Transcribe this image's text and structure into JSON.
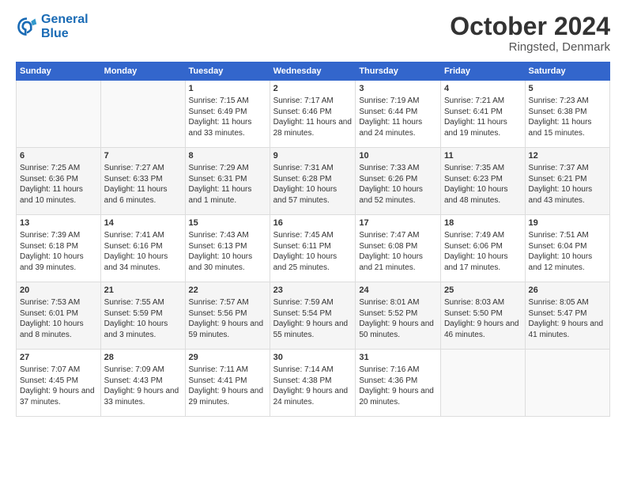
{
  "header": {
    "logo_line1": "General",
    "logo_line2": "Blue",
    "month": "October 2024",
    "location": "Ringsted, Denmark"
  },
  "days_of_week": [
    "Sunday",
    "Monday",
    "Tuesday",
    "Wednesday",
    "Thursday",
    "Friday",
    "Saturday"
  ],
  "weeks": [
    [
      {
        "day": "",
        "sunrise": "",
        "sunset": "",
        "daylight": ""
      },
      {
        "day": "",
        "sunrise": "",
        "sunset": "",
        "daylight": ""
      },
      {
        "day": "1",
        "sunrise": "Sunrise: 7:15 AM",
        "sunset": "Sunset: 6:49 PM",
        "daylight": "Daylight: 11 hours and 33 minutes."
      },
      {
        "day": "2",
        "sunrise": "Sunrise: 7:17 AM",
        "sunset": "Sunset: 6:46 PM",
        "daylight": "Daylight: 11 hours and 28 minutes."
      },
      {
        "day": "3",
        "sunrise": "Sunrise: 7:19 AM",
        "sunset": "Sunset: 6:44 PM",
        "daylight": "Daylight: 11 hours and 24 minutes."
      },
      {
        "day": "4",
        "sunrise": "Sunrise: 7:21 AM",
        "sunset": "Sunset: 6:41 PM",
        "daylight": "Daylight: 11 hours and 19 minutes."
      },
      {
        "day": "5",
        "sunrise": "Sunrise: 7:23 AM",
        "sunset": "Sunset: 6:38 PM",
        "daylight": "Daylight: 11 hours and 15 minutes."
      }
    ],
    [
      {
        "day": "6",
        "sunrise": "Sunrise: 7:25 AM",
        "sunset": "Sunset: 6:36 PM",
        "daylight": "Daylight: 11 hours and 10 minutes."
      },
      {
        "day": "7",
        "sunrise": "Sunrise: 7:27 AM",
        "sunset": "Sunset: 6:33 PM",
        "daylight": "Daylight: 11 hours and 6 minutes."
      },
      {
        "day": "8",
        "sunrise": "Sunrise: 7:29 AM",
        "sunset": "Sunset: 6:31 PM",
        "daylight": "Daylight: 11 hours and 1 minute."
      },
      {
        "day": "9",
        "sunrise": "Sunrise: 7:31 AM",
        "sunset": "Sunset: 6:28 PM",
        "daylight": "Daylight: 10 hours and 57 minutes."
      },
      {
        "day": "10",
        "sunrise": "Sunrise: 7:33 AM",
        "sunset": "Sunset: 6:26 PM",
        "daylight": "Daylight: 10 hours and 52 minutes."
      },
      {
        "day": "11",
        "sunrise": "Sunrise: 7:35 AM",
        "sunset": "Sunset: 6:23 PM",
        "daylight": "Daylight: 10 hours and 48 minutes."
      },
      {
        "day": "12",
        "sunrise": "Sunrise: 7:37 AM",
        "sunset": "Sunset: 6:21 PM",
        "daylight": "Daylight: 10 hours and 43 minutes."
      }
    ],
    [
      {
        "day": "13",
        "sunrise": "Sunrise: 7:39 AM",
        "sunset": "Sunset: 6:18 PM",
        "daylight": "Daylight: 10 hours and 39 minutes."
      },
      {
        "day": "14",
        "sunrise": "Sunrise: 7:41 AM",
        "sunset": "Sunset: 6:16 PM",
        "daylight": "Daylight: 10 hours and 34 minutes."
      },
      {
        "day": "15",
        "sunrise": "Sunrise: 7:43 AM",
        "sunset": "Sunset: 6:13 PM",
        "daylight": "Daylight: 10 hours and 30 minutes."
      },
      {
        "day": "16",
        "sunrise": "Sunrise: 7:45 AM",
        "sunset": "Sunset: 6:11 PM",
        "daylight": "Daylight: 10 hours and 25 minutes."
      },
      {
        "day": "17",
        "sunrise": "Sunrise: 7:47 AM",
        "sunset": "Sunset: 6:08 PM",
        "daylight": "Daylight: 10 hours and 21 minutes."
      },
      {
        "day": "18",
        "sunrise": "Sunrise: 7:49 AM",
        "sunset": "Sunset: 6:06 PM",
        "daylight": "Daylight: 10 hours and 17 minutes."
      },
      {
        "day": "19",
        "sunrise": "Sunrise: 7:51 AM",
        "sunset": "Sunset: 6:04 PM",
        "daylight": "Daylight: 10 hours and 12 minutes."
      }
    ],
    [
      {
        "day": "20",
        "sunrise": "Sunrise: 7:53 AM",
        "sunset": "Sunset: 6:01 PM",
        "daylight": "Daylight: 10 hours and 8 minutes."
      },
      {
        "day": "21",
        "sunrise": "Sunrise: 7:55 AM",
        "sunset": "Sunset: 5:59 PM",
        "daylight": "Daylight: 10 hours and 3 minutes."
      },
      {
        "day": "22",
        "sunrise": "Sunrise: 7:57 AM",
        "sunset": "Sunset: 5:56 PM",
        "daylight": "Daylight: 9 hours and 59 minutes."
      },
      {
        "day": "23",
        "sunrise": "Sunrise: 7:59 AM",
        "sunset": "Sunset: 5:54 PM",
        "daylight": "Daylight: 9 hours and 55 minutes."
      },
      {
        "day": "24",
        "sunrise": "Sunrise: 8:01 AM",
        "sunset": "Sunset: 5:52 PM",
        "daylight": "Daylight: 9 hours and 50 minutes."
      },
      {
        "day": "25",
        "sunrise": "Sunrise: 8:03 AM",
        "sunset": "Sunset: 5:50 PM",
        "daylight": "Daylight: 9 hours and 46 minutes."
      },
      {
        "day": "26",
        "sunrise": "Sunrise: 8:05 AM",
        "sunset": "Sunset: 5:47 PM",
        "daylight": "Daylight: 9 hours and 41 minutes."
      }
    ],
    [
      {
        "day": "27",
        "sunrise": "Sunrise: 7:07 AM",
        "sunset": "Sunset: 4:45 PM",
        "daylight": "Daylight: 9 hours and 37 minutes."
      },
      {
        "day": "28",
        "sunrise": "Sunrise: 7:09 AM",
        "sunset": "Sunset: 4:43 PM",
        "daylight": "Daylight: 9 hours and 33 minutes."
      },
      {
        "day": "29",
        "sunrise": "Sunrise: 7:11 AM",
        "sunset": "Sunset: 4:41 PM",
        "daylight": "Daylight: 9 hours and 29 minutes."
      },
      {
        "day": "30",
        "sunrise": "Sunrise: 7:14 AM",
        "sunset": "Sunset: 4:38 PM",
        "daylight": "Daylight: 9 hours and 24 minutes."
      },
      {
        "day": "31",
        "sunrise": "Sunrise: 7:16 AM",
        "sunset": "Sunset: 4:36 PM",
        "daylight": "Daylight: 9 hours and 20 minutes."
      },
      {
        "day": "",
        "sunrise": "",
        "sunset": "",
        "daylight": ""
      },
      {
        "day": "",
        "sunrise": "",
        "sunset": "",
        "daylight": ""
      }
    ]
  ]
}
